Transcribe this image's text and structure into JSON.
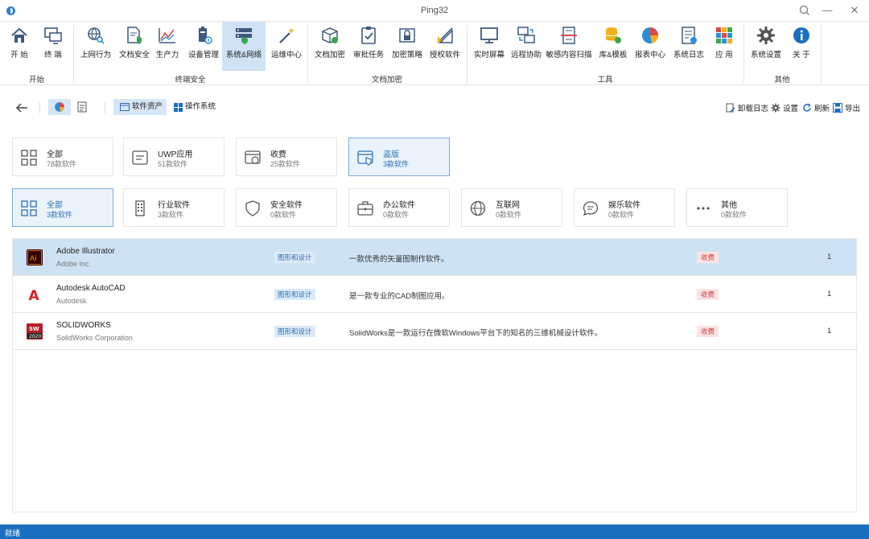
{
  "window": {
    "title": "Ping32",
    "search_icon": "search-icon",
    "min": "—",
    "max": "☐",
    "close": "✕"
  },
  "ribbon": {
    "items": [
      {
        "label": "开 始",
        "icon": "home-icon"
      },
      {
        "label": "终 端",
        "icon": "terminal-icon"
      },
      {
        "label": "上网行为",
        "icon": "web-behavior-icon"
      },
      {
        "label": "文档安全",
        "icon": "document-security-icon"
      },
      {
        "label": "生产力",
        "icon": "productivity-icon"
      },
      {
        "label": "设备管理",
        "icon": "device-management-icon"
      },
      {
        "label": "系统&网络",
        "icon": "system-network-icon",
        "active": true
      },
      {
        "label": "运维中心",
        "icon": "magic-wand-icon"
      },
      {
        "label": "文档加密",
        "icon": "document-encrypt-icon"
      },
      {
        "label": "审批任务",
        "icon": "approval-task-icon"
      },
      {
        "label": "加密策略",
        "icon": "encrypt-policy-icon"
      },
      {
        "label": "授权软件",
        "icon": "authorized-software-icon"
      },
      {
        "label": "实时屏幕",
        "icon": "monitor-icon"
      },
      {
        "label": "远程协助",
        "icon": "remote-assist-icon"
      },
      {
        "label": "敏感内容扫描",
        "icon": "sensitive-scan-icon"
      },
      {
        "label": "库&模板",
        "icon": "database-template-icon"
      },
      {
        "label": "报表中心",
        "icon": "pie-chart-icon"
      },
      {
        "label": "系统日志",
        "icon": "system-log-icon"
      },
      {
        "label": "应 用",
        "icon": "apps-grid-icon"
      },
      {
        "label": "系统设置",
        "icon": "gear-icon"
      },
      {
        "label": "关 于",
        "icon": "info-icon"
      }
    ],
    "groups": [
      "开始",
      "终端安全",
      "文档加密",
      "工具",
      "其他"
    ]
  },
  "toolbar": {
    "back_icon": "back-arrow-icon",
    "view_chart_icon": "pie-chart-icon",
    "view_list_icon": "document-list-icon",
    "tab_software_assets": "软件资产",
    "tab_os": "操作系统",
    "uninstall_log": "卸载日志",
    "settings": "设置",
    "refresh": "刷新",
    "export": "导出"
  },
  "license_cards": [
    {
      "title": "全部",
      "sub": "78款软件",
      "icon": "grid-icon"
    },
    {
      "title": "UWP应用",
      "sub": "51款软件",
      "icon": "uwp-app-icon"
    },
    {
      "title": "收费",
      "sub": "25款软件",
      "icon": "paid-icon"
    },
    {
      "title": "盗版",
      "sub": "3款软件",
      "icon": "pirated-icon",
      "selected": true
    }
  ],
  "category_cards": [
    {
      "title": "全部",
      "sub": "3款软件",
      "icon": "grid-icon",
      "selected": true
    },
    {
      "title": "行业软件",
      "sub": "3款软件",
      "icon": "building-icon"
    },
    {
      "title": "安全软件",
      "sub": "0款软件",
      "icon": "shield-icon"
    },
    {
      "title": "办公软件",
      "sub": "0款软件",
      "icon": "briefcase-icon"
    },
    {
      "title": "互联网",
      "sub": "0款软件",
      "icon": "globe-icon"
    },
    {
      "title": "娱乐软件",
      "sub": "0款软件",
      "icon": "chat-bubble-icon"
    },
    {
      "title": "其他",
      "sub": "0款软件",
      "icon": "more-dots-icon"
    }
  ],
  "software": [
    {
      "name": "Adobe Illustrator",
      "vendor": "Adobe Inc.",
      "category": "图形和设计",
      "description": "一款优秀的矢量图制作软件。",
      "license": "收费",
      "count": "1",
      "logo": "illustrator-logo-icon",
      "logo_text": "Ai"
    },
    {
      "name": "Autodesk AutoCAD",
      "vendor": "Autodesk",
      "category": "图形和设计",
      "description": "是一款专业的CAD制图应用。",
      "license": "收费",
      "count": "1",
      "logo": "autocad-logo-icon",
      "logo_text": "A"
    },
    {
      "name": "SOLIDWORKS",
      "vendor": "SolidWorks Corporation",
      "category": "图形和设计",
      "description": "SolidWorks是一款运行在微软Windows平台下的知名的三维机械设计软件。",
      "license": "收费",
      "count": "1",
      "logo": "solidworks-logo-icon",
      "logo_text": "2020"
    }
  ],
  "status": {
    "text": "就绪"
  },
  "colors": {
    "accent": "#1a6fc0",
    "selected_row": "#cde2f4",
    "ribbon_active": "#cfe3f5",
    "paid_badge": "#d43b3b"
  }
}
